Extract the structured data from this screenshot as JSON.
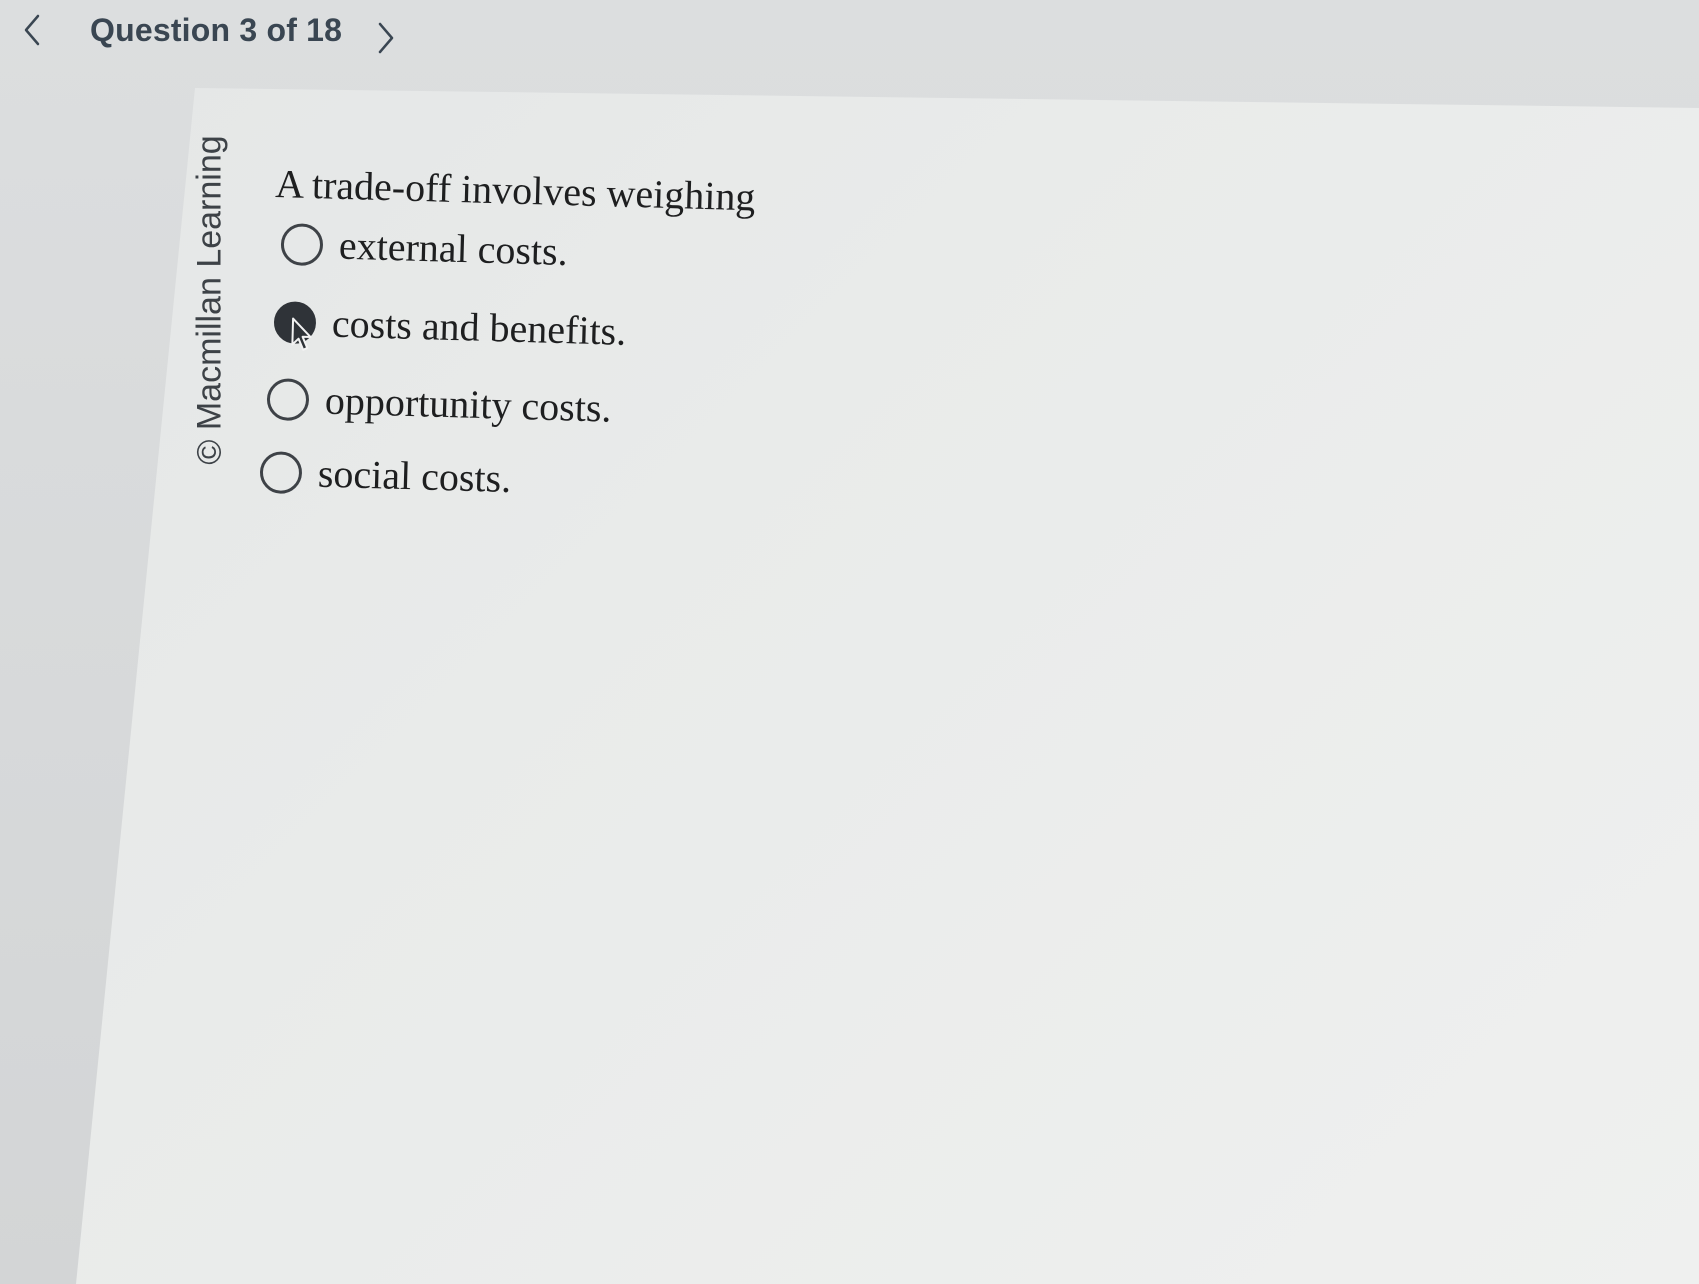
{
  "header": {
    "counter_text": "Question 3 of 18",
    "prev_icon": "chevron-left-icon",
    "next_icon": "chevron-right-icon"
  },
  "watermark": {
    "text": "© Macmillan Learning"
  },
  "question": {
    "prompt": "A trade-off involves weighing",
    "options": [
      {
        "label": "external costs.",
        "selected": false
      },
      {
        "label": "costs and benefits.",
        "selected": true
      },
      {
        "label": "opportunity costs.",
        "selected": false
      },
      {
        "label": "social costs.",
        "selected": false
      }
    ]
  },
  "colors": {
    "text": "#1e1f20",
    "header_text": "#3a4652",
    "radio_border": "#3e4247",
    "radio_selected": "#2f3338"
  }
}
